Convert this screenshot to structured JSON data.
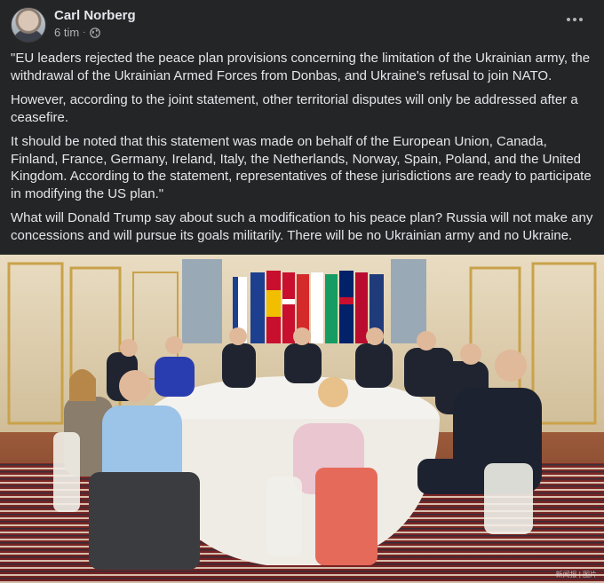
{
  "post": {
    "author": "Carl Norberg",
    "time": "6 tim",
    "separator": "·",
    "privacy_icon": "globe-icon",
    "more_icon": "more-options-icon",
    "paragraphs": [
      "\"EU leaders rejected the peace plan provisions concerning the limitation of the Ukrainian army, the withdrawal of the Ukrainian Armed Forces from Donbas, and Ukraine's refusal to join NATO.",
      "However, according to the joint statement, other territorial disputes will only be addressed after a ceasefire.",
      "It should be noted that this statement was made on behalf of the European Union, Canada, Finland, France, Germany, Ireland, Italy, the Netherlands, Norway, Spain, Poland, and the United Kingdom. According to the statement, representatives of these jurisdictions are ready to participate in modifying the US plan.\"",
      "What will Donald Trump say about such a modification to his peace plan? Russia will not make any concessions and will pursue its goals militarily. There will be no Ukrainian army and no Ukraine."
    ],
    "photo": {
      "watermark": "新闻报 | 图片"
    }
  },
  "colors": {
    "background": "#242526",
    "text_primary": "#e4e6eb",
    "text_secondary": "#b0b3b8"
  }
}
